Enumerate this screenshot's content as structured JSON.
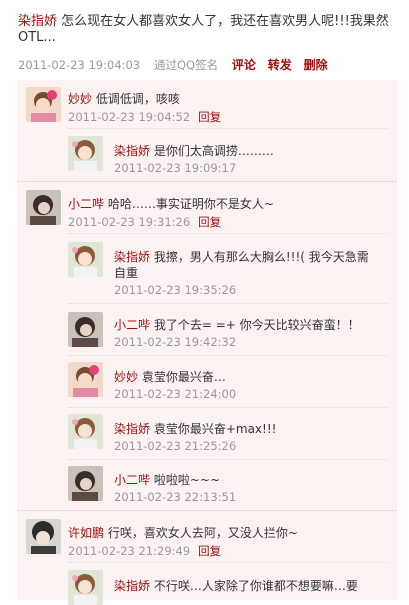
{
  "status": {
    "author": "染指娇",
    "text_line1": " 怎么现在女人都喜欢女人了，我还在喜欢男人呢!!!我果然",
    "text_line2": "OTL...",
    "time": "2011-02-23 19:04:03",
    "source": "通过QQ签名",
    "actions": [
      "评论",
      "转发",
      "删除"
    ]
  },
  "comments": [
    {
      "author": "妙妙",
      "text": " 低调低调，咳咳",
      "time": "2011-02-23 19:04:52",
      "reply": "回复",
      "avatar": "girl-pink-avatar",
      "replies": [
        {
          "author": "染指娇",
          "text": " 是你们太高调捞………",
          "time": "2011-02-23 19:09:17",
          "avatar": "girl-tea-avatar"
        }
      ]
    },
    {
      "author": "小二哔",
      "text": " 哈哈……事实证明你不是女人~",
      "time": "2011-02-23 19:31:26",
      "reply": "回复",
      "avatar": "girl-dark-avatar",
      "replies": [
        {
          "author": "染指娇",
          "text": " 我擦，男人有那么大胸么!!!( 我今天急需",
          "text2": "自重",
          "time": "2011-02-23 19:35:26",
          "avatar": "girl-tea-avatar"
        },
        {
          "author": "小二哔",
          "text": " 我了个去= =+ 你今天比较兴奋蛮！！",
          "time": "2011-02-23 19:42:32",
          "avatar": "girl-dark-avatar"
        },
        {
          "author": "妙妙",
          "text": " 袁莹你最兴奋…",
          "time": "2011-02-23 21:24:00",
          "avatar": "girl-pink-avatar"
        },
        {
          "author": "染指娇",
          "text": " 袁莹你最兴奋+max!!!",
          "time": "2011-02-23 21:25:26",
          "avatar": "girl-tea-avatar"
        },
        {
          "author": "小二哔",
          "text": " 啦啦啦~~~",
          "time": "2011-02-23 22:13:51",
          "avatar": "girl-dark-avatar"
        }
      ]
    },
    {
      "author": "许如鹏",
      "text": " 行咲，喜欢女人去阿，又没人拦你~",
      "time": "2011-02-23 21:29:49",
      "reply": "回复",
      "avatar": "anime-boy-avatar",
      "replies": [
        {
          "author": "染指娇",
          "text": " 不行咲…人家除了你谁都不想要嘛…要",
          "time": "",
          "avatar": "girl-tea-avatar"
        }
      ]
    }
  ]
}
